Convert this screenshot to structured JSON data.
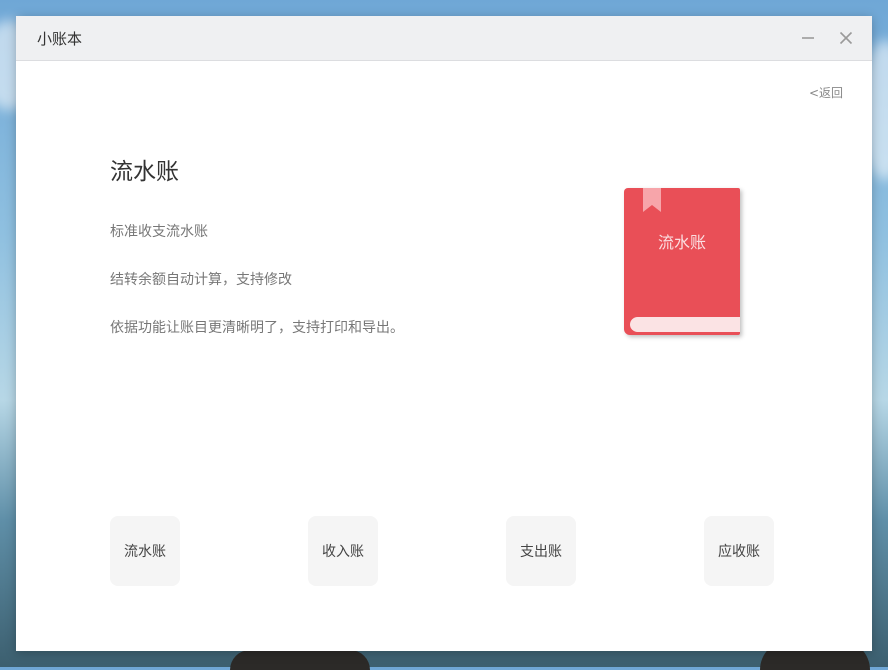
{
  "window": {
    "title": "小账本",
    "minimize_icon": "minimize-icon",
    "close_icon": "close-icon"
  },
  "back_link": "<返回",
  "main": {
    "heading": "流水账",
    "descriptions": [
      "标准收支流水账",
      "结转余额自动计算，支持修改",
      "依据功能让账目更清晰明了，支持打印和导出。"
    ]
  },
  "book": {
    "label": "流水账",
    "color": "#e94f57",
    "pages_color": "#fbe3e4",
    "ribbon_color": "#f7a5aa"
  },
  "nav_buttons": [
    {
      "label": "流水账"
    },
    {
      "label": "收入账"
    },
    {
      "label": "支出账"
    },
    {
      "label": "应收账"
    }
  ]
}
